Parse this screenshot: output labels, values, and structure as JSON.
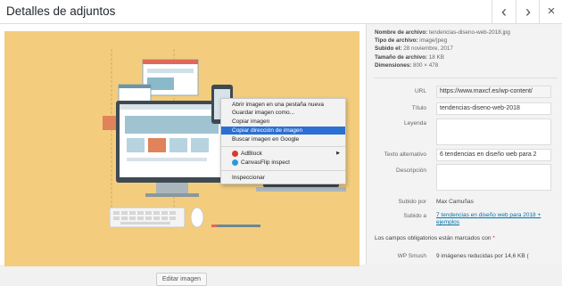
{
  "header": {
    "title": "Detalles de adjuntos",
    "prev_icon": "‹",
    "next_icon": "›",
    "close_icon": "×"
  },
  "image": {
    "bg": "#f3cd7d"
  },
  "edit_button": "Editar imagen",
  "meta": {
    "filename_label": "Nombre de archivo:",
    "filename": "tendencias-diseno-web-2018.jpg",
    "filetype_label": "Tipo de archivo:",
    "filetype": "image/jpeg",
    "uploaded_label": "Subido el:",
    "uploaded": "28 noviembre, 2017",
    "size_label": "Tamaño de archivo:",
    "size": "18 KB",
    "dims_label": "Dimensiones:",
    "dims": "800 × 478"
  },
  "fields": {
    "url_label": "URL",
    "url": "https://www.maxcf.es/wp-content/",
    "title_label": "Título",
    "title": "tendencias-diseno-web-2018",
    "caption_label": "Leyenda",
    "caption": "",
    "alt_label": "Texto alternativo",
    "alt": "6 tendencias en diseño web para 2",
    "desc_label": "Descripción",
    "desc": "",
    "uploaded_by_label": "Subido por",
    "uploaded_by": "Max Camuñas",
    "uploaded_to_label": "Subido a",
    "uploaded_to": "7 tendencias en diseño web para 2018 + ejemplos",
    "required_note": "Los campos obligatorios están marcados con",
    "required_star": "*",
    "smush_label": "WP Smush",
    "smush": "9 imágenes reducidas por 14,6 KB ("
  },
  "context_menu": [
    "Abrir imagen en una pestaña nueva",
    "Guardar imagen como...",
    "Copiar imagen",
    "Copiar dirección de imagen",
    "Buscar imagen en Google",
    "AdBlock",
    "CanvasFlip inspect",
    "Inspeccionar"
  ],
  "submenu_arrow": "▶"
}
